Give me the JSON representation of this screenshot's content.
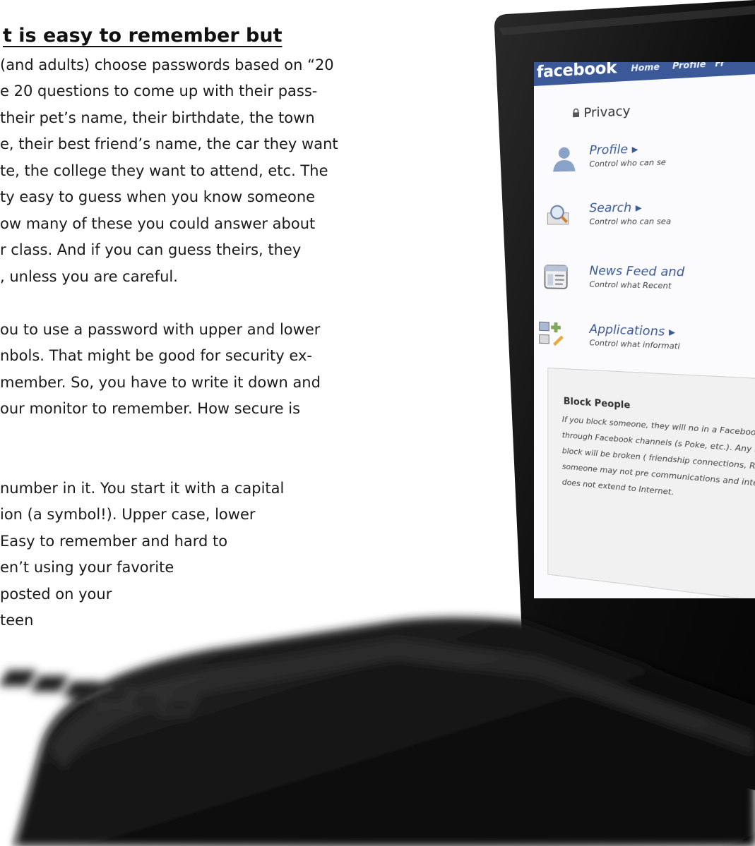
{
  "article": {
    "heading": "t is easy to remember but",
    "lines": [
      "(and adults) choose passwords based on “20",
      "e 20 questions to come up with their pass-",
      "their pet’s name, their birthdate, the town",
      "e, their best friend’s name, the car they want",
      "te, the college they want to attend, etc. The",
      "ty easy to guess when you know someone",
      "ow many of these you could answer about",
      "r class. And if you can guess theirs, they",
      ", unless you are careful.",
      "",
      "ou to use a password with upper and lower",
      "nbols. That might be good for security ex-",
      "member. So, you have to write it down and",
      "our monitor to remember. How secure is",
      "",
      "",
      "number in it. You start it with a capital",
      "ion (a symbol!).  Upper case, lower",
      "Easy to remember and hard to",
      "en’t using your favorite",
      "posted on your",
      "teen"
    ]
  },
  "facebook": {
    "logo": "facebook",
    "nav": [
      "Home",
      "Profile",
      "Fr"
    ],
    "privacy_title": "Privacy",
    "settings": [
      {
        "title": "Profile ▸",
        "desc": "Control who can se",
        "icon": "profile-person-icon"
      },
      {
        "title": "Search ▸",
        "desc": "Control who can sea",
        "icon": "search-magnifier-icon"
      },
      {
        "title": "News Feed and",
        "desc": "Control what Recent",
        "icon": "news-feed-icon"
      },
      {
        "title": "Applications ▸",
        "desc": "Control what informati",
        "icon": "applications-icon"
      }
    ],
    "block": {
      "title": "Block People",
      "text": "If you block someone, they will no in a Facebook search, see your pr you through Facebook channels (s Poke, etc.). Any Facebook ties yo a person you block will be broken ( friendship connections, Relationship that blocking someone may not pre communications and interactions in t applications, and does not extend to Internet."
    },
    "colors": {
      "bar": "#3b5998",
      "link": "#3b5998"
    }
  }
}
